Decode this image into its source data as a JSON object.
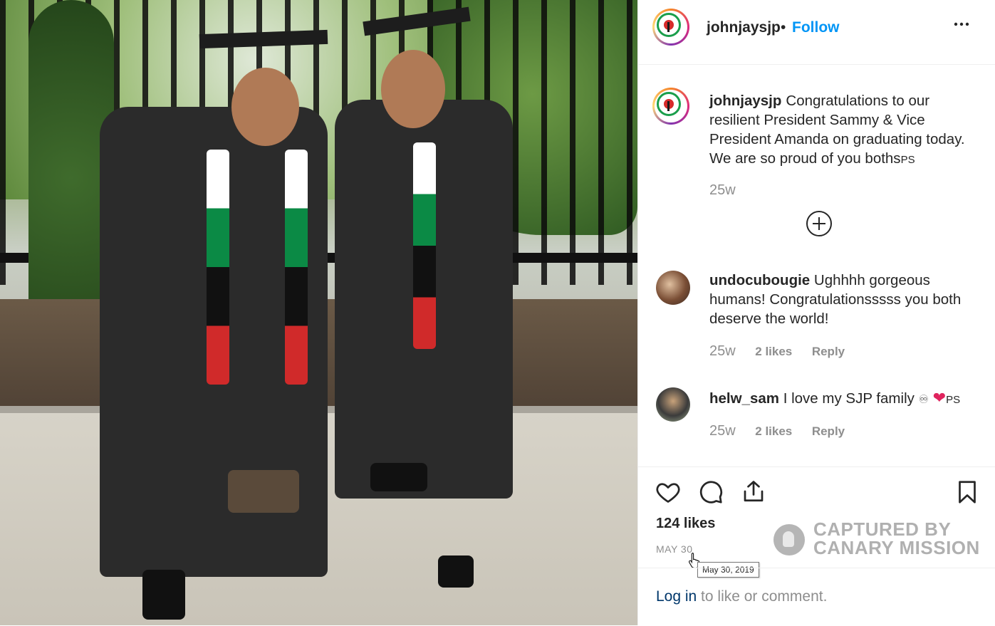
{
  "post": {
    "username": "johnjaysjp",
    "dot": "•",
    "follow_label": "Follow",
    "more_label": "•••",
    "caption_text": "Congratulations to our resilient President Sammy & Vice President Amanda on graduating today. We are so proud of you boths",
    "caption_suffix": "PS",
    "caption_time": "25w"
  },
  "comments": [
    {
      "username": "undocubougie",
      "text": "Ughhhh gorgeous humans! Congratulationsssss you both deserve the world!",
      "time": "25w",
      "likes": "2 likes",
      "reply": "Reply"
    },
    {
      "username": "helw_sam",
      "text": "I love my SJP family",
      "emoji_infinity": "♾",
      "emoji_heart": "❤",
      "suffix": "PS",
      "time": "25w",
      "likes": "2 likes",
      "reply": "Reply"
    }
  ],
  "footer": {
    "likes": "124 likes",
    "date": "MAY 30",
    "tooltip": "May 30, 2019",
    "login_link": "Log in",
    "login_rest": " to like or comment."
  },
  "watermark": {
    "line1": "CAPTURED BY",
    "line2": "CANARY MISSION"
  },
  "icons": [
    "heart-icon",
    "comment-icon",
    "share-icon",
    "bookmark-icon",
    "add-circle-icon",
    "more-icon"
  ],
  "colors": {
    "follow": "#0095f6",
    "text": "#262626",
    "muted": "#8e8e8e",
    "link": "#00376b",
    "heart": "#e0245e"
  }
}
